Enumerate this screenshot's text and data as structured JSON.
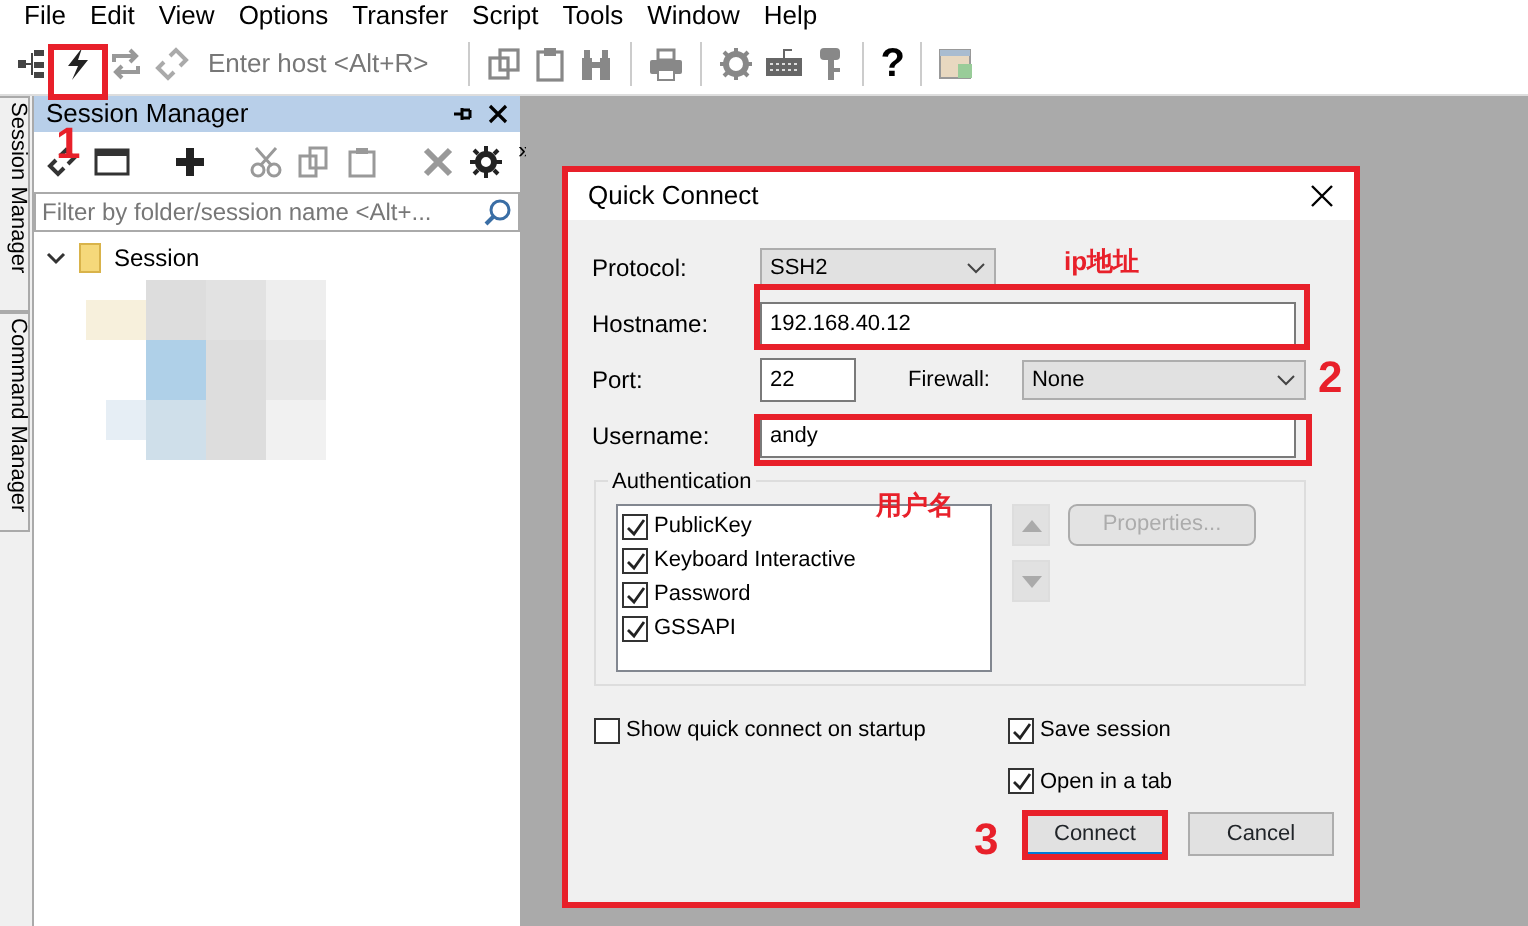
{
  "menu": [
    "File",
    "Edit",
    "View",
    "Options",
    "Transfer",
    "Script",
    "Tools",
    "Window",
    "Help"
  ],
  "toolbar": {
    "host_placeholder": "Enter host <Alt+R>",
    "help_glyph": "?"
  },
  "side_tabs": [
    "Session Manager",
    "Command Manager"
  ],
  "session_manager": {
    "title": "Session Manager",
    "overflow": "»",
    "filter_placeholder": "Filter by folder/session name <Alt+...",
    "tree": [
      {
        "label": "Session",
        "expanded": true
      }
    ]
  },
  "dialog": {
    "title": "Quick Connect",
    "fields": [
      {
        "label": "Protocol:",
        "kind": "select",
        "value": "SSH2"
      },
      {
        "label": "Hostname:",
        "kind": "text",
        "value": "192.168.40.12"
      },
      {
        "label": "Port:",
        "kind": "port",
        "value": "22",
        "extra_label": "Firewall:",
        "extra_value": "None"
      },
      {
        "label": "Username:",
        "kind": "text",
        "value": "andy"
      }
    ],
    "auth_label": "Authentication",
    "auth_methods": [
      {
        "label": "PublicKey",
        "checked": true
      },
      {
        "label": "Keyboard Interactive",
        "checked": true
      },
      {
        "label": "Password",
        "checked": true
      },
      {
        "label": "GSSAPI",
        "checked": true
      }
    ],
    "properties_button": {
      "label": "Properties...",
      "disabled": true
    },
    "startup_option": {
      "label": "Show quick connect on startup",
      "checked": false
    },
    "options": [
      {
        "label": "Save session",
        "checked": true
      },
      {
        "label": "Open in a tab",
        "checked": true
      }
    ],
    "buttons": [
      {
        "label": "Connect",
        "default": true
      },
      {
        "label": "Cancel",
        "default": false
      }
    ]
  },
  "annotations": {
    "step_1": "1",
    "step_2": "2",
    "step_3": "3",
    "ip_note": "ip地址",
    "user_note": "用户名"
  }
}
